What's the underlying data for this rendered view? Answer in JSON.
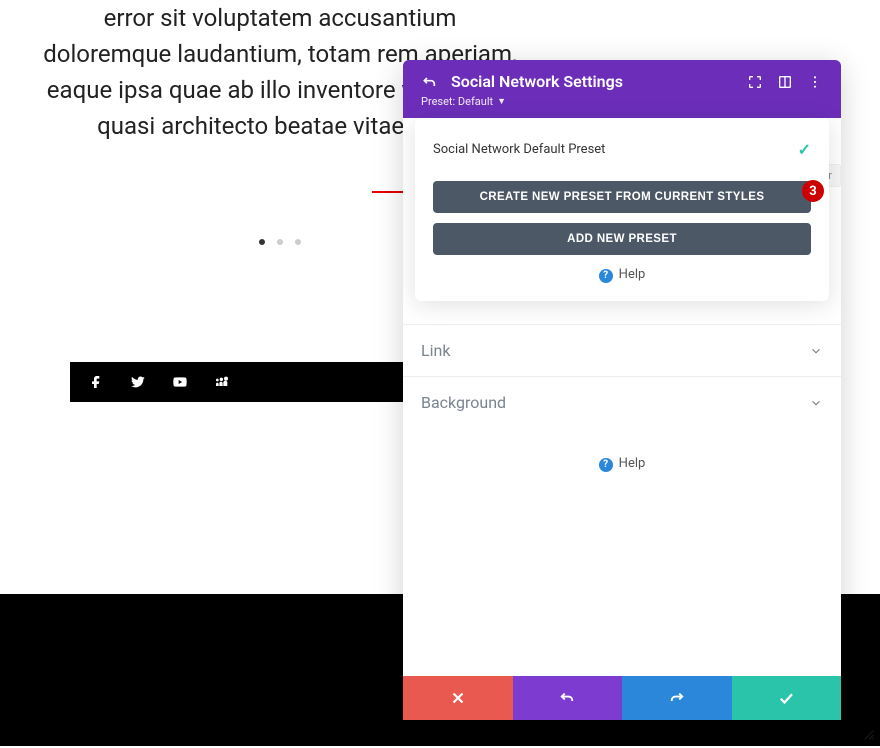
{
  "bg": {
    "paragraph": "error sit voluptatem accusantium doloremque laudantium, totam rem aperiam, eaque ipsa quae ab illo inventore veritatis et quasi architecto beatae vitae dicta"
  },
  "annotation": {
    "step_number": "3"
  },
  "social_icons": [
    "facebook",
    "twitter",
    "youtube",
    "myspace"
  ],
  "modal": {
    "title": "Social Network Settings",
    "preset_label": "Preset: Default",
    "pop": {
      "current_name": "Social Network Default Preset",
      "create_btn": "CREATE NEW PRESET FROM CURRENT STYLES",
      "add_btn": "ADD NEW PRESET",
      "help": "Help"
    },
    "tab_hint": "er",
    "sections": {
      "link": "Link",
      "background": "Background"
    },
    "body_help": "Help"
  }
}
